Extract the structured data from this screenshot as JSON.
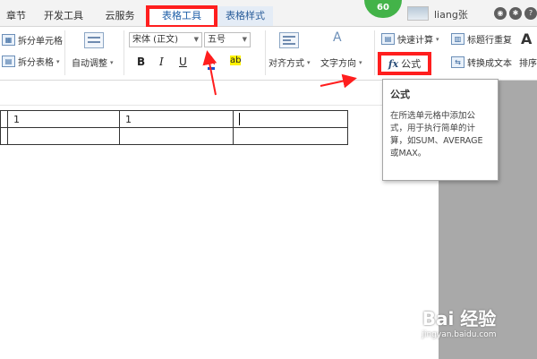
{
  "tabs": {
    "chapter": "章节",
    "developer": "开发工具",
    "cloud": "云服务",
    "table_tools": "表格工具",
    "table_style": "表格样式"
  },
  "status_badge": "60",
  "user": {
    "name": "liang张"
  },
  "ribbon": {
    "split_cell": "拆分单元格",
    "split_table": "拆分表格",
    "auto_fit": "自动调整",
    "font_name": "宋体 (正文)",
    "font_size": "五号",
    "bold": "B",
    "italic": "I",
    "underline": "U",
    "font_color": "A",
    "highlight": "ab",
    "align": "对齐方式",
    "text_direction": "文字方向",
    "quick_calc": "快速计算",
    "repeat_header": "标题行重复",
    "convert_text": "转换成文本",
    "sort": "排序",
    "formula": "公式",
    "fx": "fx",
    "text_dir_glyph": "A"
  },
  "tooltip": {
    "title": "公式",
    "description": "在所选单元格中添加公式，用于执行简单的计算，如SUM、AVERAGE或MAX。"
  },
  "table": {
    "rows": [
      [
        "1",
        "1",
        ""
      ],
      [
        "",
        "",
        ""
      ]
    ]
  },
  "watermark": {
    "main": "Bai 经验",
    "sub": "jingyan.baidu.com"
  },
  "colors": {
    "highlight_red": "#ff1e1e",
    "badge_green": "#43b349",
    "side_gray": "#a9a9a9"
  }
}
